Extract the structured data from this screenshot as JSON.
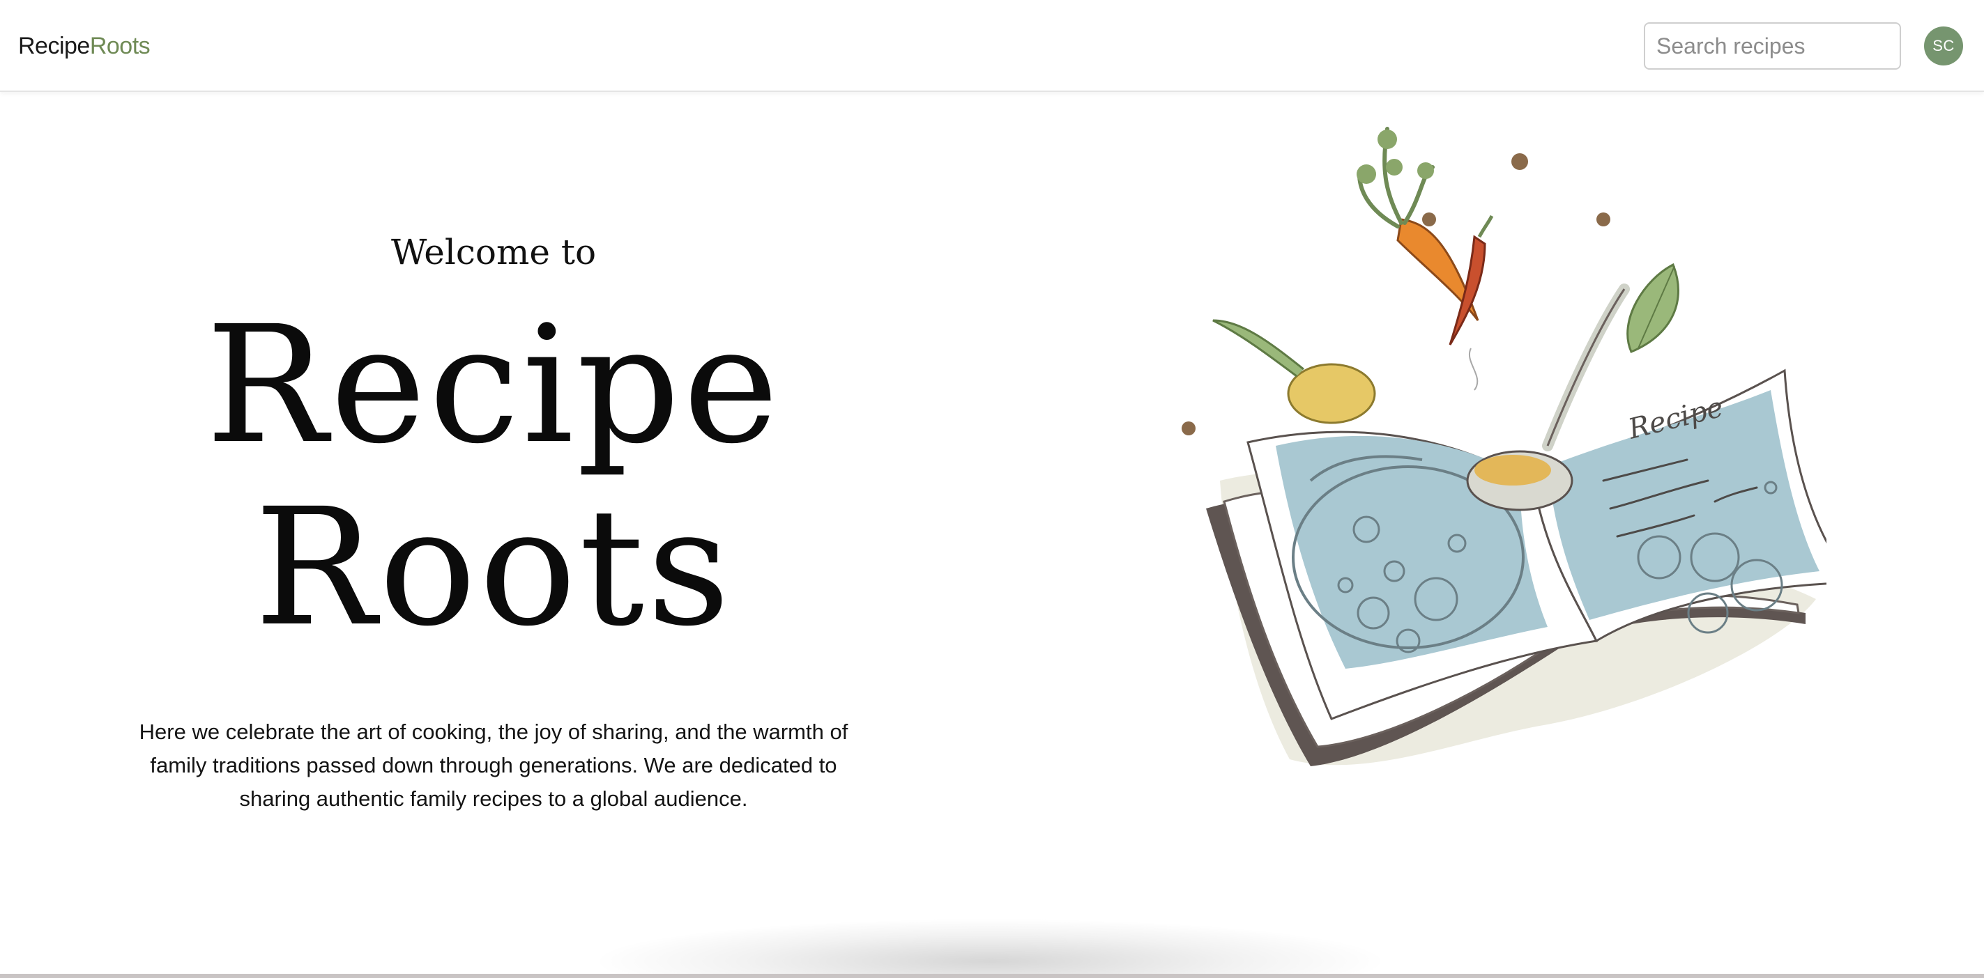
{
  "header": {
    "logo_part1": "Recipe",
    "logo_part2": "Roots",
    "search_placeholder": "Search recipes",
    "avatar_initials": "SC"
  },
  "hero": {
    "welcome": "Welcome to",
    "title_line1": "Recipe",
    "title_line2": "Roots",
    "intro": "Here we celebrate the art of cooking, the joy of sharing, and the warmth of family traditions passed down through generations. We are dedicated to sharing authentic family recipes to a global audience."
  },
  "illustration": {
    "book_label": "Recipe",
    "icons": [
      "open-recipe-book-icon",
      "ladle-icon",
      "carrot-icon",
      "chili-pepper-icon",
      "leaf-icon",
      "onion-icon",
      "peppercorn-icon"
    ]
  },
  "colors": {
    "brand_green": "#6f8a55",
    "avatar_green": "#76956f",
    "book_blue": "#a9c8d2",
    "carrot_orange": "#e9892e"
  }
}
